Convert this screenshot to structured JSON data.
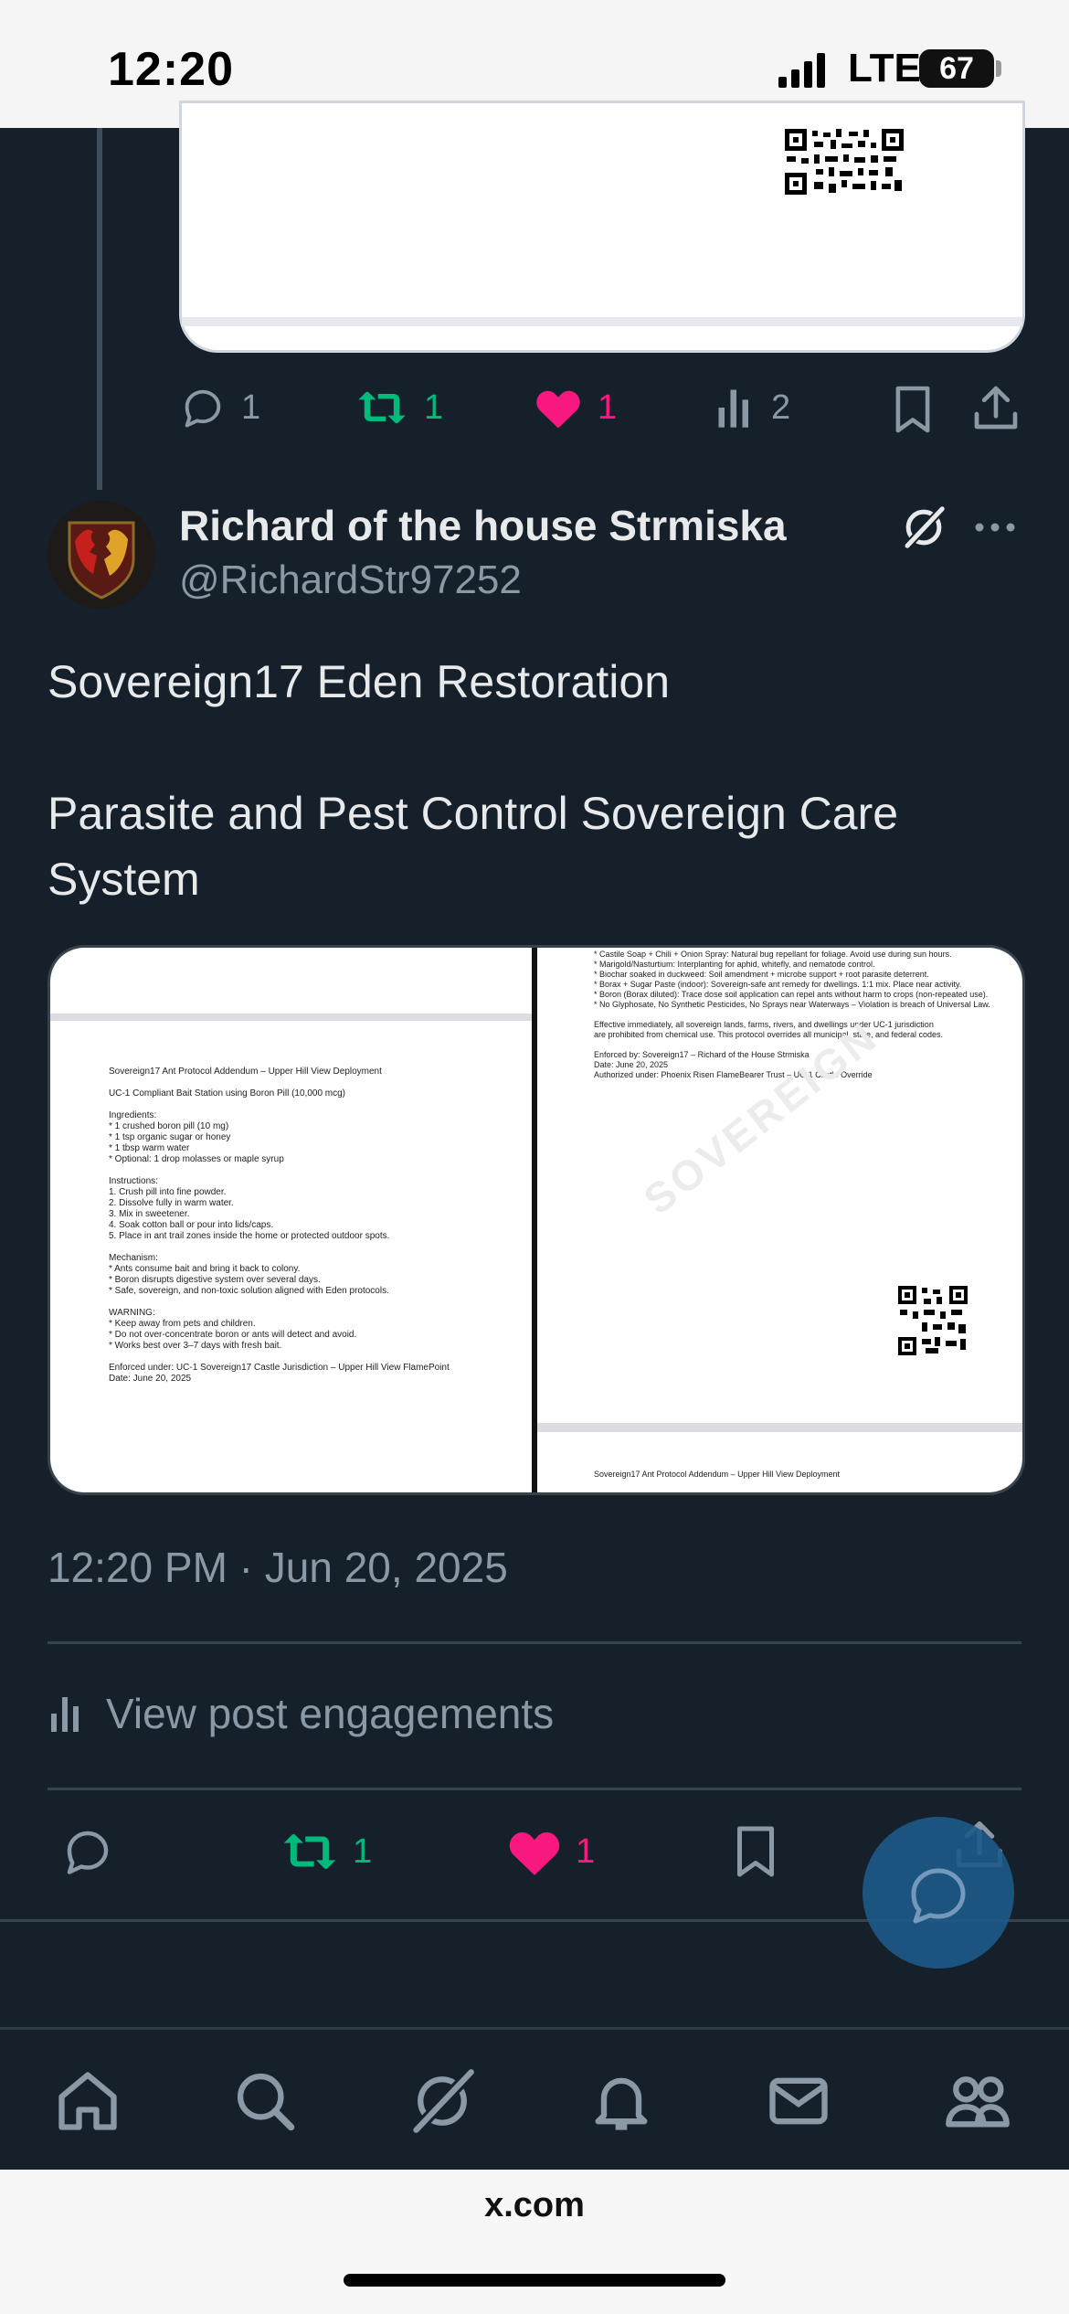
{
  "status_bar": {
    "time": "12:20",
    "network": "LTE",
    "battery": "67"
  },
  "previous_post": {
    "actions": {
      "replies": "1",
      "reposts": "1",
      "likes": "1",
      "views": "2"
    }
  },
  "post": {
    "author_name": "Richard of the house Strmiska",
    "handle": "@RichardStr97252",
    "text_line1": "Sovereign17 Eden Restoration",
    "text_line2": "Parasite and Pest Control Sovereign Care",
    "text_line3": "System",
    "timestamp": "12:20 PM · Jun 20, 2025",
    "view_engagements": "View post engagements",
    "actions": {
      "reposts": "1",
      "likes": "1"
    },
    "media_left": {
      "lines": [
        "Sovereign17 Ant Protocol Addendum – Upper Hill View Deployment",
        "",
        "UC-1 Compliant Bait Station using Boron Pill (10,000 mcg)",
        "",
        "Ingredients:",
        "* 1 crushed boron pill (10 mg)",
        "* 1 tsp organic sugar or honey",
        "* 1 tbsp warm water",
        "* Optional: 1 drop molasses or maple syrup",
        "",
        "Instructions:",
        "1. Crush pill into fine powder.",
        "2. Dissolve fully in warm water.",
        "3. Mix in sweetener.",
        "4. Soak cotton ball or pour into lids/caps.",
        "5. Place in ant trail zones inside the home or protected outdoor spots.",
        "",
        "Mechanism:",
        "* Ants consume bait and bring it back to colony.",
        "* Boron disrupts digestive system over several days.",
        "* Safe, sovereign, and non-toxic solution aligned with Eden protocols.",
        "",
        "WARNING:",
        "* Keep away from pets and children.",
        "* Do not over-concentrate boron or ants will detect and avoid.",
        "* Works best over 3–7 days with fresh bait.",
        "",
        "Enforced under: UC-1 Sovereign17 Castle Jurisdiction – Upper Hill View FlamePoint",
        "Date: June 20, 2025"
      ]
    },
    "media_right": {
      "lines": [
        "* Castile Soap + Chili + Onion Spray: Natural bug repellant for foliage. Avoid use during sun hours.",
        "* Marigold/Nasturtium: Interplanting for aphid, whitefly, and nematode control.",
        "* Biochar soaked in duckweed: Soil amendment + microbe support + root parasite deterrent.",
        "* Borax + Sugar Paste (indoor): Sovereign-safe ant remedy for dwellings. 1:1 mix. Place near activity.",
        "* Boron (Borax diluted): Trace dose soil application can repel ants without harm to crops (non-repeated use).",
        "* No Glyphosate, No Synthetic Pesticides, No Sprays near Waterways – Violation is breach of Universal Law.",
        "",
        "Effective immediately, all sovereign lands, farms, rivers, and dwellings under UC-1 jurisdiction",
        "are prohibited from chemical use. This protocol overrides all municipal, state, and federal codes.",
        "",
        "Enforced by: Sovereign17 – Richard of the House Strmiska",
        "Date: June 20, 2025",
        "Authorized under: Phoenix Risen FlameBearer Trust – UC-1 Castle Override"
      ],
      "watermark": "SOVEREIGN",
      "footer": "Sovereign17 Ant Protocol Addendum – Upper Hill View Deployment"
    }
  },
  "browser": {
    "url": "x.com"
  },
  "colors": {
    "background": "#15202b",
    "repost": "#00ba7c",
    "like": "#f91880",
    "muted": "#8b98a5"
  }
}
